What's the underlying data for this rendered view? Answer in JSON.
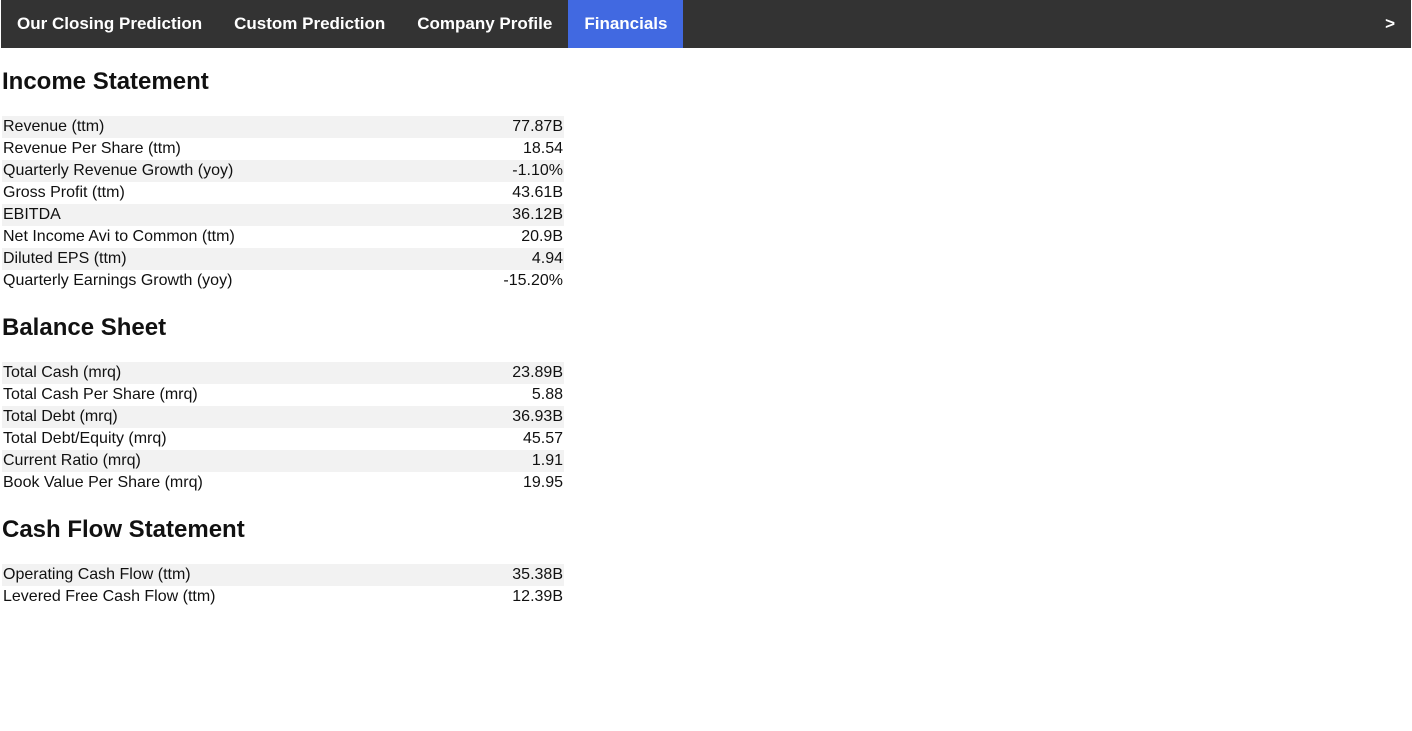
{
  "nav": {
    "tabs": [
      {
        "label": "Our Closing Prediction"
      },
      {
        "label": "Custom Prediction"
      },
      {
        "label": "Company Profile"
      },
      {
        "label": "Financials"
      }
    ],
    "next_label": ">"
  },
  "income": {
    "title": "Income Statement",
    "rows": [
      {
        "label": "Revenue (ttm)",
        "value": "77.87B"
      },
      {
        "label": "Revenue Per Share (ttm)",
        "value": "18.54"
      },
      {
        "label": "Quarterly Revenue Growth (yoy)",
        "value": "-1.10%"
      },
      {
        "label": "Gross Profit (ttm)",
        "value": "43.61B"
      },
      {
        "label": "EBITDA",
        "value": "36.12B"
      },
      {
        "label": "Net Income Avi to Common (ttm)",
        "value": "20.9B"
      },
      {
        "label": "Diluted EPS (ttm)",
        "value": "4.94"
      },
      {
        "label": "Quarterly Earnings Growth (yoy)",
        "value": "-15.20%"
      }
    ]
  },
  "balance": {
    "title": "Balance Sheet",
    "rows": [
      {
        "label": "Total Cash (mrq)",
        "value": "23.89B"
      },
      {
        "label": "Total Cash Per Share (mrq)",
        "value": "5.88"
      },
      {
        "label": "Total Debt (mrq)",
        "value": "36.93B"
      },
      {
        "label": "Total Debt/Equity (mrq)",
        "value": "45.57"
      },
      {
        "label": "Current Ratio (mrq)",
        "value": "1.91"
      },
      {
        "label": "Book Value Per Share (mrq)",
        "value": "19.95"
      }
    ]
  },
  "cashflow": {
    "title": "Cash Flow Statement",
    "rows": [
      {
        "label": "Operating Cash Flow (ttm)",
        "value": "35.38B"
      },
      {
        "label": "Levered Free Cash Flow (ttm)",
        "value": "12.39B"
      }
    ]
  }
}
